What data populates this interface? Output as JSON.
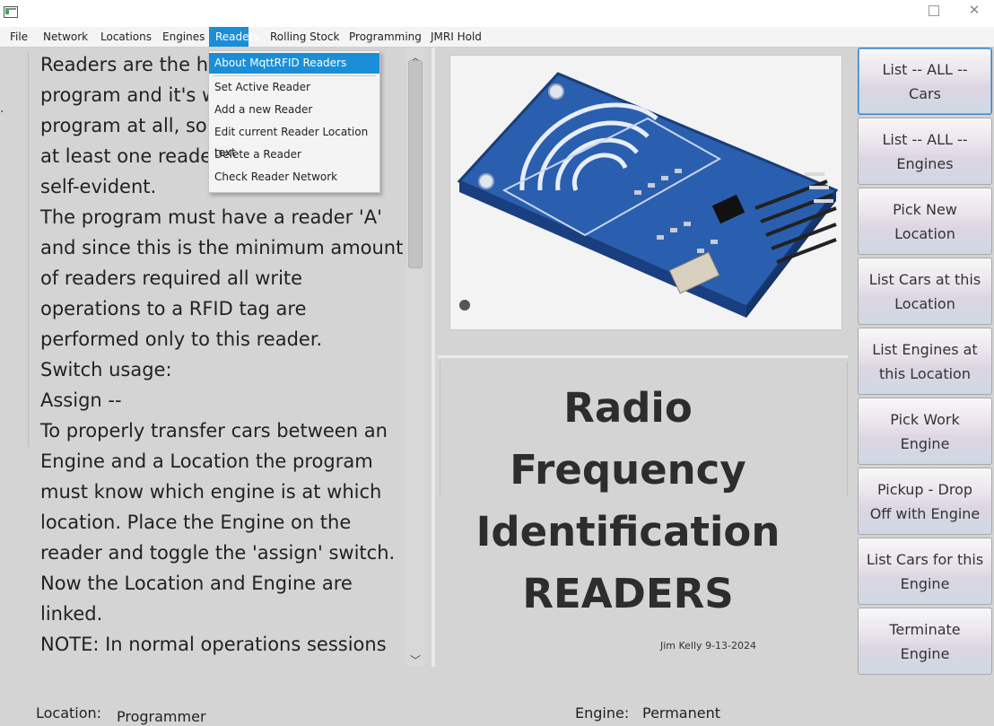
{
  "window": {
    "close_glyph": "✕"
  },
  "menubar": {
    "items": [
      "File",
      "Network",
      "Locations",
      "Engines",
      "Readers",
      "Rolling Stock",
      "Programming",
      "JMRI Hold"
    ],
    "active": "Readers"
  },
  "readers_menu": {
    "items": [
      "About MqttRFID Readers",
      "Set Active Reader",
      "Add a new Reader",
      "Edit current Reader Location text",
      "Delete a Reader",
      "Check Reader Network"
    ],
    "highlighted": "About MqttRFID Readers"
  },
  "text_panel": {
    "body": "Readers are the heart of the\nprogram and it's w...\nprogram at all, so t...\nat least one reader...\nself-evident.\nThe program must have a reader 'A'\nand since this is the minimum amount\nof readers required all write\noperations to a RFID tag are\nperformed only to this reader.\nSwitch usage:\nAssign --\nTo properly transfer cars between an\nEngine and a Location the program\nmust know which engine is at which\nlocation. Place the Engine on the\nreader and toggle the 'assign' switch.\nNow the Location and Engine are\nlinked.\nNOTE: In normal operations sessions",
    "lines": [
      "Readers are the he",
      "program and it's w",
      "program at all, so t",
      "at least one reader",
      "self-evident.",
      "The program must have a reader 'A'",
      "and since this is the minimum amount",
      "of readers required all write",
      "operations to a RFID tag are",
      "performed only to this reader.",
      "Switch usage:",
      "Assign --",
      "To properly transfer cars between an",
      "Engine and a Location the program",
      "must know which engine is at which",
      "location. Place the Engine on the",
      "reader and toggle the 'assign' switch.",
      "Now the Location and Engine are",
      "linked.",
      "NOTE: In normal operations sessions"
    ]
  },
  "center": {
    "title_lines": [
      "Radio Frequency",
      "Identification",
      "READERS"
    ],
    "signature": "Jim Kelly 9-13-2024"
  },
  "sidebar": {
    "buttons": [
      "List -- ALL -- Cars",
      "List -- ALL -- Engines",
      "Pick New Location",
      "List Cars at this Location",
      "List Engines at this Location",
      "Pick Work Engine",
      "Pickup - Drop Off with Engine",
      "List Cars for this Engine",
      "Terminate Engine"
    ]
  },
  "status": {
    "location_label": "Location:",
    "location_value": "Programmer",
    "engine_label": "Engine:",
    "engine_value": "Permanent"
  },
  "colors": {
    "menu_highlight": "#1a8fd8",
    "window_bg": "#d4d4d4",
    "rfid_board": "#2a5fb0"
  }
}
